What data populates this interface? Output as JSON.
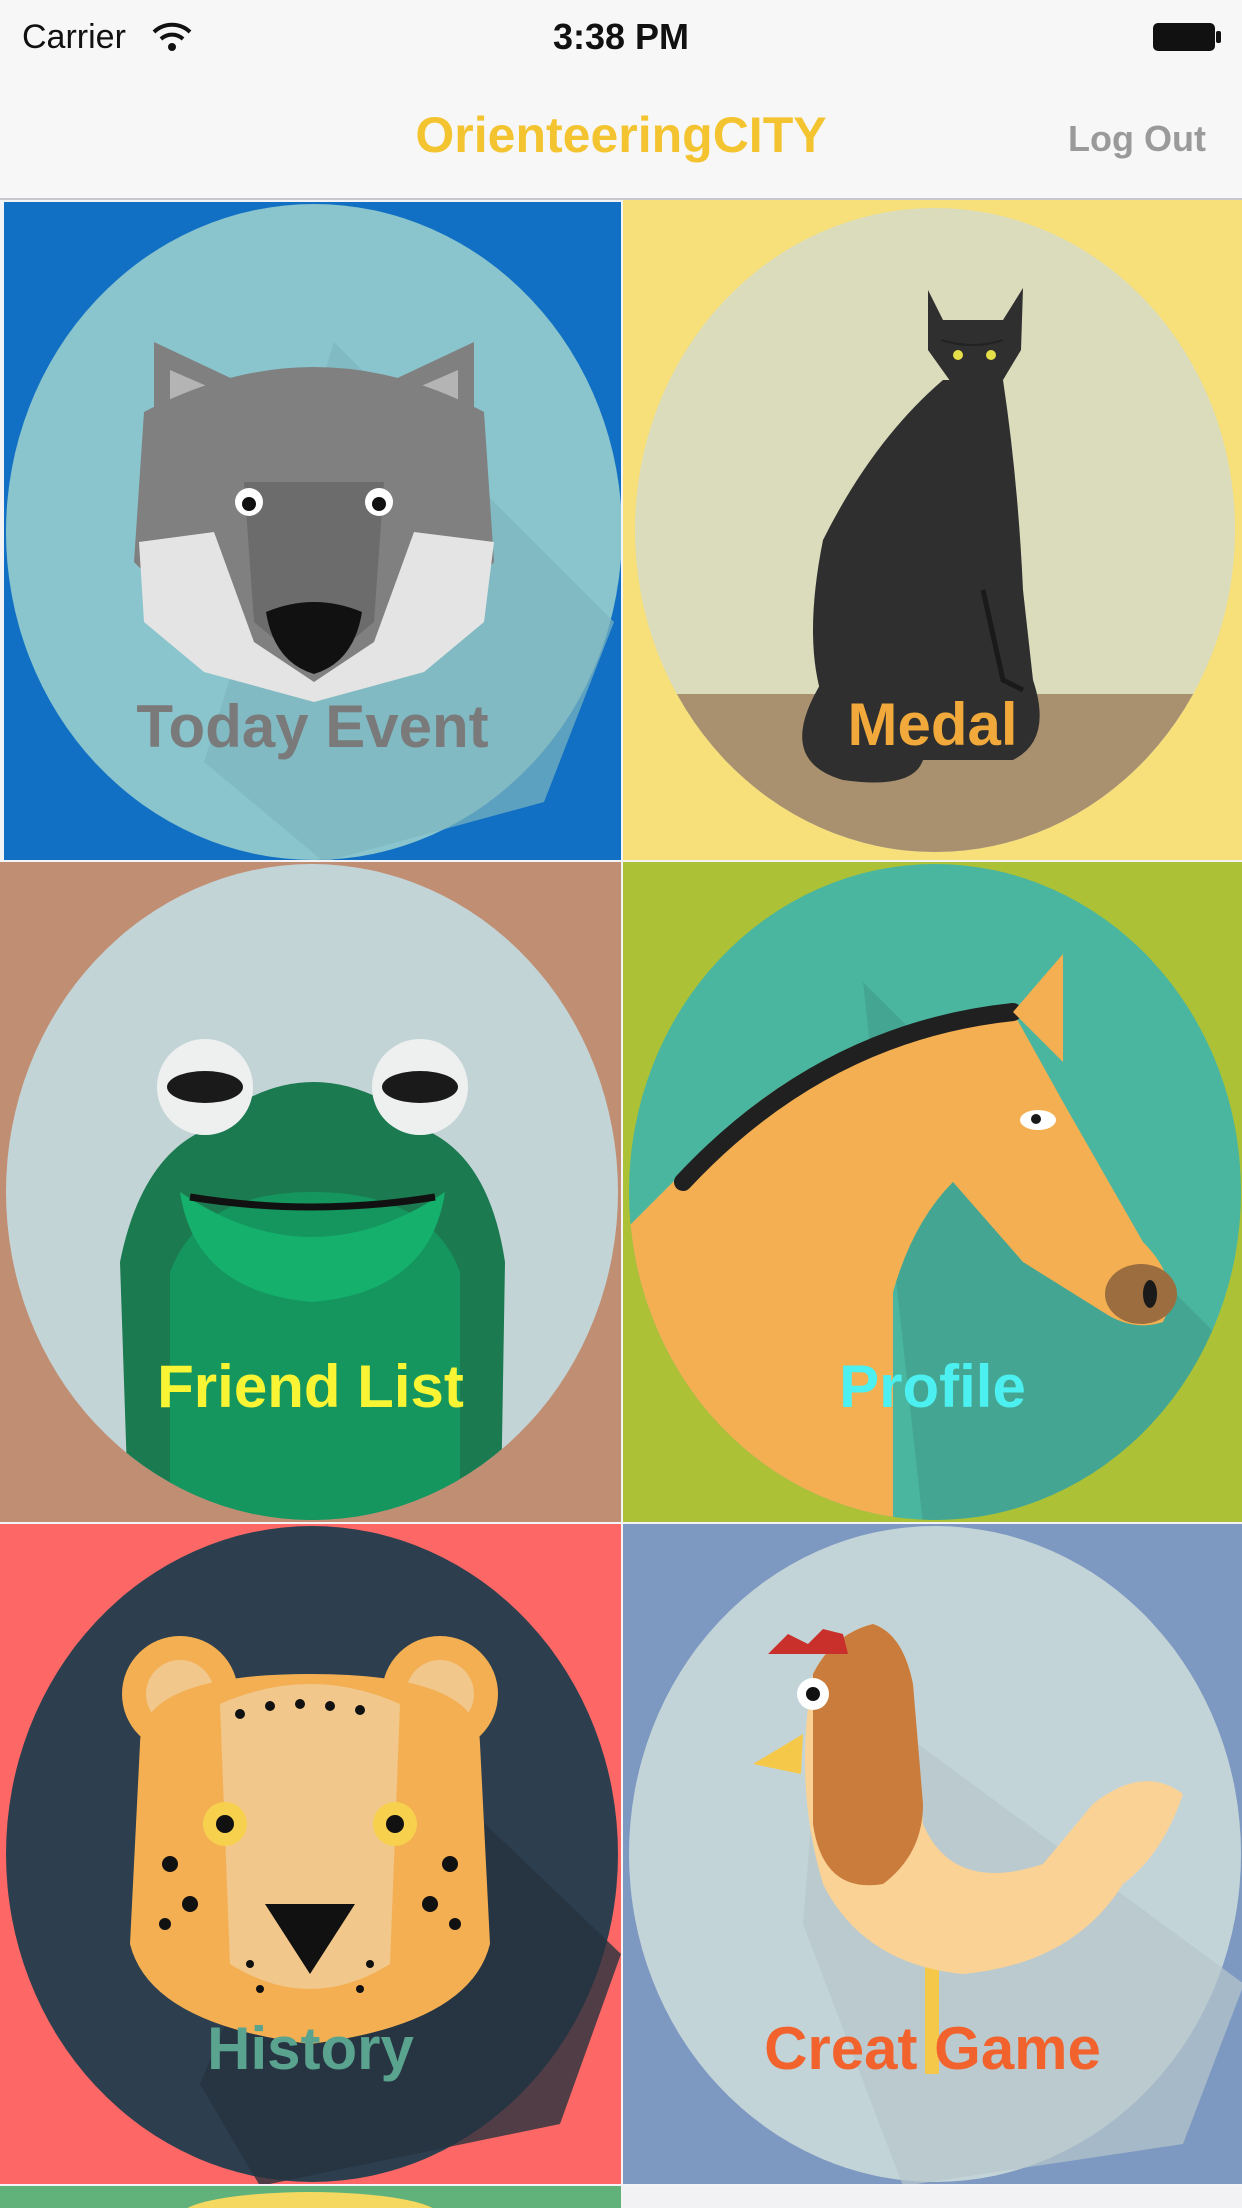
{
  "status_bar": {
    "carrier": "Carrier",
    "time": "3:38 PM",
    "wifi_icon": "wifi-icon",
    "battery_icon": "battery-icon"
  },
  "nav": {
    "title": "OrienteeringCITY",
    "logout_label": "Log Out",
    "title_color": "#f4c430"
  },
  "tiles": [
    {
      "label": "Today Event",
      "animal": "wolf-icon",
      "bg": "#1170c4",
      "circle": "#8ac4cc",
      "label_color": "#7a7a7a"
    },
    {
      "label": "Medal",
      "animal": "cat-icon",
      "bg": "#f7e07a",
      "circle": "#dadcbc",
      "label_color": "#f0a93a"
    },
    {
      "label": "Friend List",
      "animal": "frog-icon",
      "bg": "#c08e72",
      "circle": "#c3d4d7",
      "label_color": "#f9f535"
    },
    {
      "label": "Profile",
      "animal": "horse-icon",
      "bg": "#adc136",
      "circle": "#4ab69f",
      "label_color": "#4cf0f0"
    },
    {
      "label": "History",
      "animal": "leopard-icon",
      "bg": "#fd6866",
      "circle": "#2d3f4f",
      "label_color": "#5aa48f"
    },
    {
      "label": "Creat Game",
      "animal": "chicken-icon",
      "bg": "#7e99c1",
      "circle": "#c3d4d8",
      "label_color": "#f2622c"
    }
  ]
}
